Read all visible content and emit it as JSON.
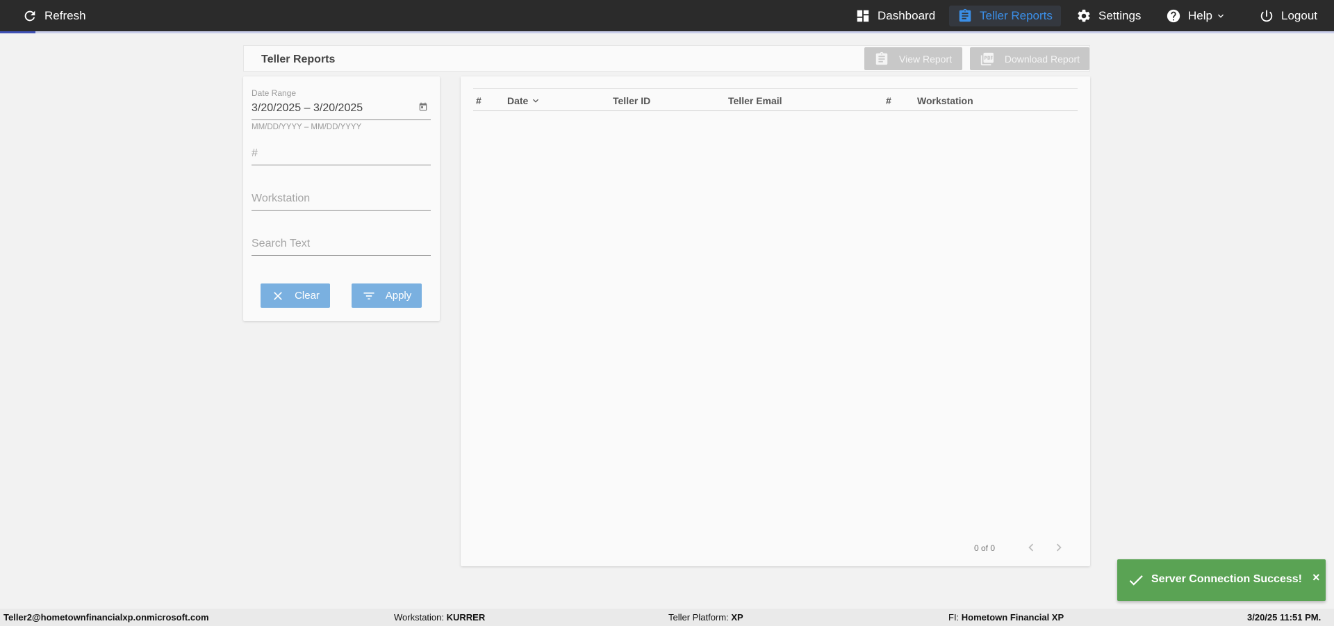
{
  "topbar": {
    "refresh_label": "Refresh",
    "nav": {
      "dashboard": "Dashboard",
      "teller_reports": "Teller Reports",
      "settings": "Settings",
      "help": "Help",
      "logout": "Logout"
    },
    "active_item": "Teller Reports",
    "accent_color": "#3b8fe8"
  },
  "titlebar": {
    "title": "Teller Reports",
    "view_report_label": "View Report",
    "download_report_label": "Download Report"
  },
  "filters": {
    "date_range_label": "Date Range",
    "date_range_value": "3/20/2025 – 3/20/2025",
    "date_range_hint": "MM/DD/YYYY – MM/DD/YYYY",
    "number_placeholder": "#",
    "workstation_placeholder": "Workstation",
    "search_placeholder": "Search Text",
    "clear_label": "Clear",
    "apply_label": "Apply"
  },
  "table": {
    "columns": [
      "#",
      "Date",
      "Teller ID",
      "Teller Email",
      "#",
      "Workstation"
    ],
    "rows": [],
    "paginator_text": "0 of 0"
  },
  "toast": {
    "message": "Server Connection Success!",
    "close_label": "×",
    "color": "#5aa354"
  },
  "statusbar": {
    "user": "Teller2@hometownfinancialxp.onmicrosoft.com",
    "workstation_label": "Workstation: ",
    "workstation_value": "KURRER",
    "platform_label": "Teller Platform: ",
    "platform_value": "XP",
    "fi_label": "FI: ",
    "fi_value": "Hometown Financial XP",
    "datetime": "3/20/25 11:51 PM."
  }
}
